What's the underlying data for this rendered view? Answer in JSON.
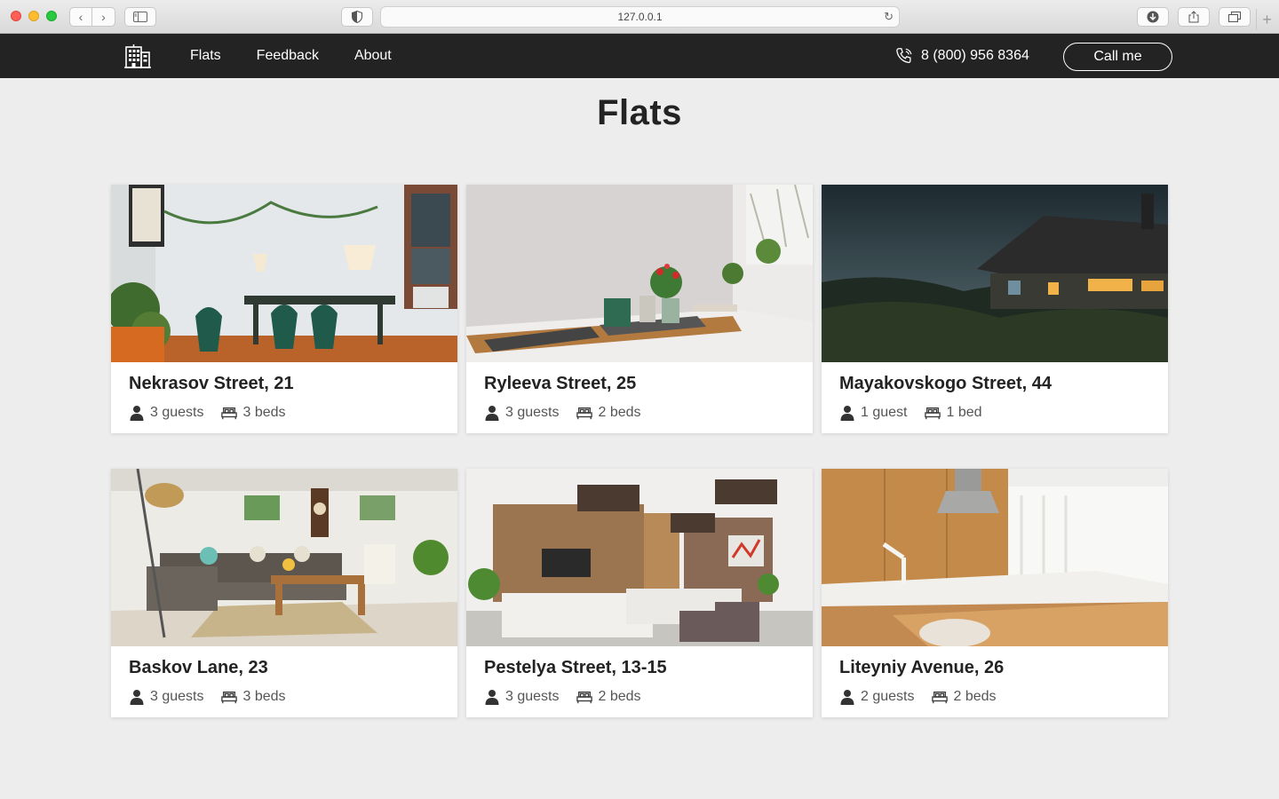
{
  "browser": {
    "url": "127.0.0.1"
  },
  "header": {
    "nav": [
      {
        "label": "Flats"
      },
      {
        "label": "Feedback"
      },
      {
        "label": "About"
      }
    ],
    "phone": "8 (800) 956 8364",
    "call_label": "Call me"
  },
  "page": {
    "title": "Flats"
  },
  "flats": [
    {
      "title": "Nekrasov Street, 21",
      "guests": "3 guests",
      "beds": "3 beds"
    },
    {
      "title": "Ryleeva Street, 25",
      "guests": "3 guests",
      "beds": "2 beds"
    },
    {
      "title": "Mayakovskogo Street, 44",
      "guests": "1 guest",
      "beds": "1 bed"
    },
    {
      "title": "Baskov Lane, 23",
      "guests": "3 guests",
      "beds": "3 beds"
    },
    {
      "title": "Pestelya Street, 13-15",
      "guests": "3 guests",
      "beds": "2 beds"
    },
    {
      "title": "Liteyniy Avenue, 26",
      "guests": "2 guests",
      "beds": "2 beds"
    }
  ],
  "icons": {
    "logo": "building-icon",
    "phone": "phone-icon",
    "guest": "person-icon",
    "bed": "bed-icon"
  },
  "colors": {
    "header_bg": "#232323",
    "page_bg": "#ededed",
    "card_bg": "#ffffff"
  }
}
